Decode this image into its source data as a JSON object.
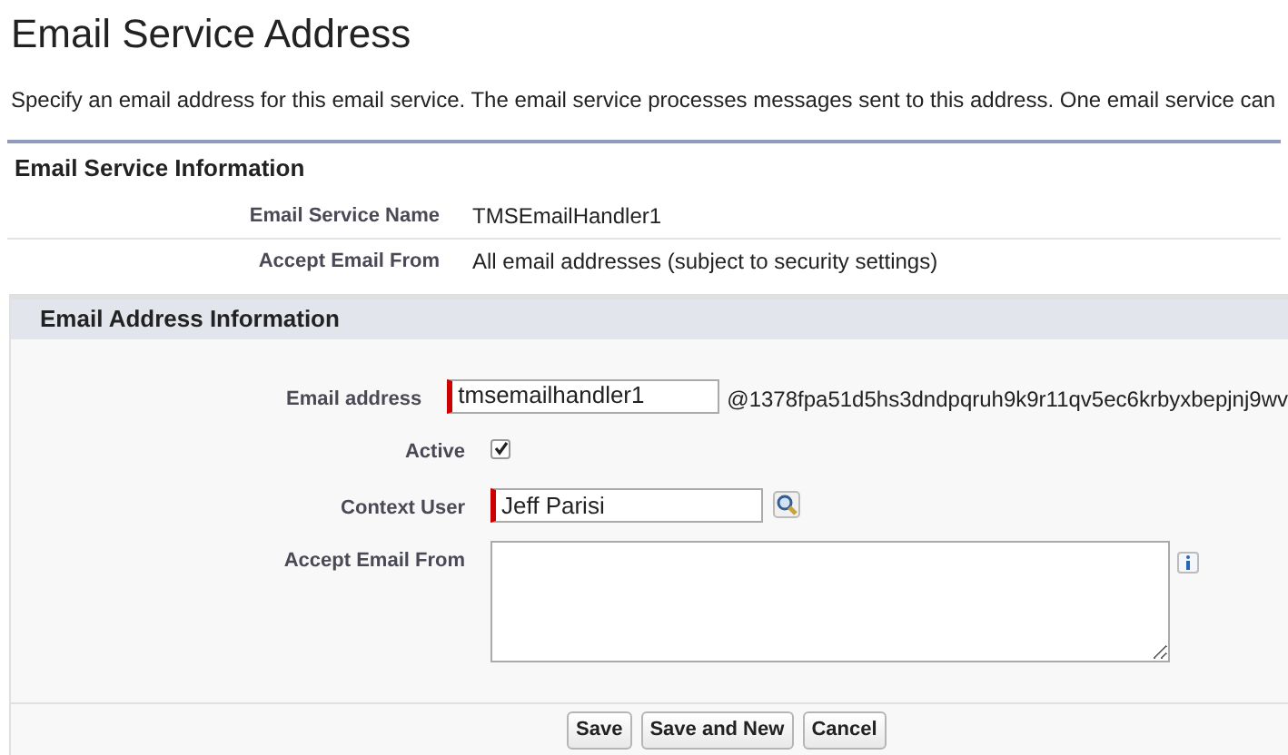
{
  "title": "Email Service Address",
  "description": "Specify an email address for this email service. The email service processes messages sent to this address. One email service can",
  "service_info": {
    "heading": "Email Service Information",
    "rows": [
      {
        "label": "Email Service Name",
        "value": "TMSEmailHandler1"
      },
      {
        "label": "Accept Email From",
        "value": "All email addresses (subject to security settings)"
      }
    ]
  },
  "address_info": {
    "heading": "Email Address Information",
    "fields": [
      {
        "kind": "text",
        "label": "Email address",
        "value": "tmsemailhandler1",
        "required": true,
        "suffix": "@1378fpa51d5hs3dndpqruh9k9r11qv5ec6krbyxbepjnj9wv"
      },
      {
        "kind": "checkbox",
        "label": "Active",
        "checked": true
      },
      {
        "kind": "lookup",
        "label": "Context User",
        "value": "Jeff Parisi",
        "required": true
      },
      {
        "kind": "textarea",
        "label": "Accept Email From"
      }
    ]
  },
  "buttons": [
    "Save",
    "Save and New",
    "Cancel"
  ]
}
